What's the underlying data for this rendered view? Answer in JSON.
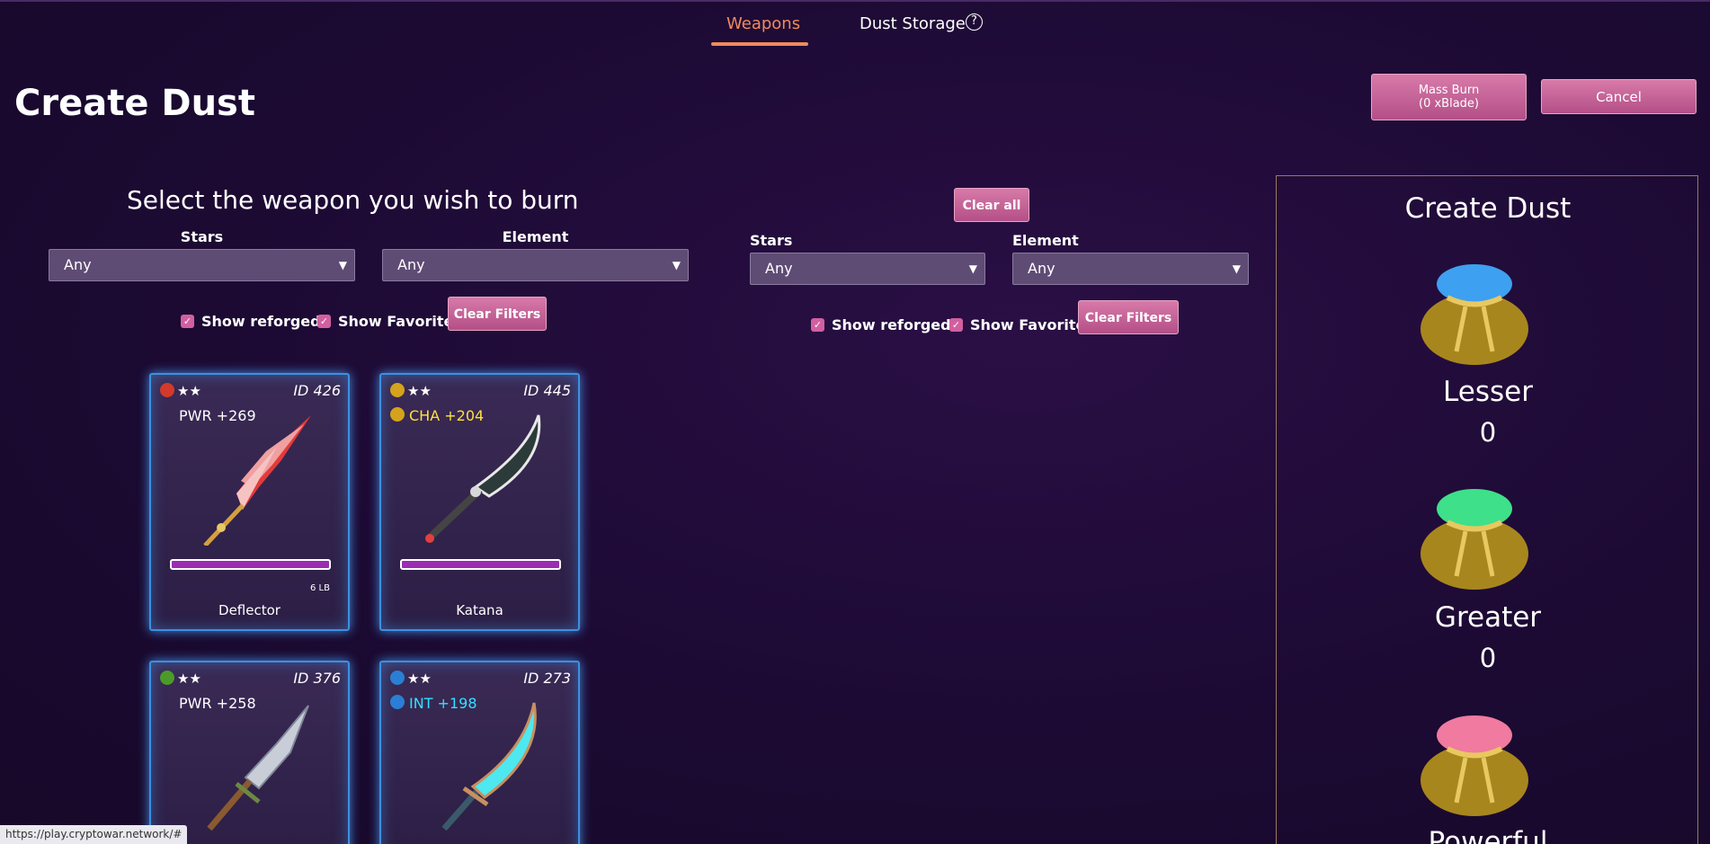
{
  "tabs": {
    "weapons": "Weapons",
    "dust_storage": "Dust Storage",
    "help_glyph": "?"
  },
  "title": "Create Dust",
  "buttons": {
    "mass_burn_line1": "Mass Burn",
    "mass_burn_line2": "(0 xBlade)",
    "cancel": "Cancel",
    "clear_all": "Clear all",
    "clear_filters": "Clear Filters"
  },
  "left_filters": {
    "heading": "Select the weapon you wish to burn",
    "stars_label": "Stars",
    "stars_value": "Any",
    "element_label": "Element",
    "element_value": "Any",
    "show_reforged": "Show reforged",
    "show_favorite": "Show Favorite",
    "show_reforged_checked": true,
    "show_favorite_checked": true
  },
  "middle_filters": {
    "stars_label": "Stars",
    "stars_value": "Any",
    "element_label": "Element",
    "element_value": "Any",
    "show_reforged": "Show reforged",
    "show_favorite": "Show Favorite"
  },
  "weapons": [
    {
      "element": "fire",
      "element_color": "#d33a2c",
      "stars": "★★",
      "id": "ID 426",
      "stat": "PWR +269",
      "stat_color": "#ffffff",
      "lb": "6 LB",
      "name": "Deflector"
    },
    {
      "element": "lightning",
      "element_color": "#d4a21c",
      "stars": "★★",
      "id": "ID 445",
      "stat": "CHA +204",
      "stat_color": "#ffe23a",
      "lb": "",
      "name": "Katana"
    },
    {
      "element": "earth",
      "element_color": "#4b9a2a",
      "stars": "★★",
      "id": "ID 376",
      "stat": "PWR +258",
      "stat_color": "#ffffff",
      "lb": "",
      "name": ""
    },
    {
      "element": "water",
      "element_color": "#2a7fd4",
      "stars": "★★",
      "id": "ID 273",
      "stat": "INT +198",
      "stat_color": "#33e0ff",
      "lb": "",
      "name": ""
    }
  ],
  "dust_panel": {
    "title": "Create Dust",
    "lesser_label": "Lesser",
    "lesser_count": "0",
    "greater_label": "Greater",
    "greater_count": "0",
    "powerful_label": "Powerful",
    "colors": {
      "lesser": "#3ea0f0",
      "greater": "#3ee08a",
      "powerful": "#f07aa0"
    }
  },
  "status_url": "https://play.cryptowar.network/#",
  "colors": {
    "accent": "#f08a5d",
    "button_pink": "#c8639b",
    "card_glow": "#3e8fe0"
  }
}
